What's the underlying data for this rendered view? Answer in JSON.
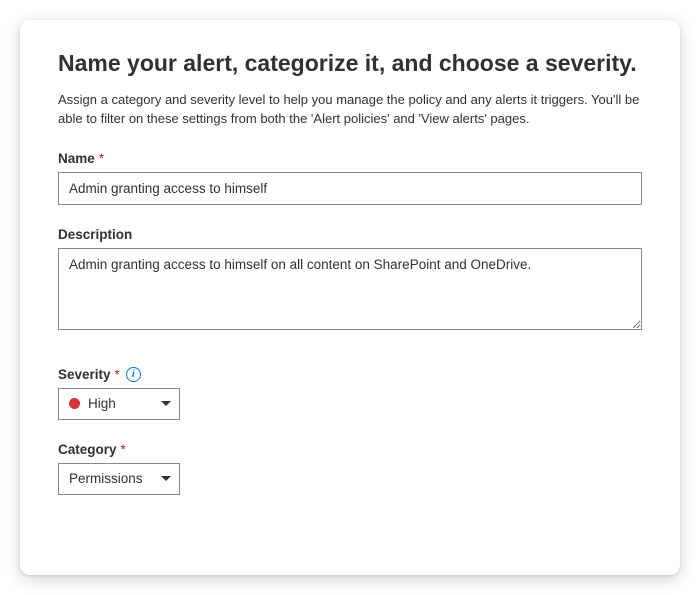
{
  "title": "Name your alert, categorize it, and choose a severity.",
  "subtitle": "Assign a category and severity level to help you manage the policy and any alerts it triggers. You'll be able to filter on these settings from both the 'Alert policies' and 'View alerts' pages.",
  "fields": {
    "name": {
      "label": "Name",
      "required_mark": "*",
      "value": "Admin granting access to himself"
    },
    "description": {
      "label": "Description",
      "value": "Admin granting access to himself on all content on SharePoint and OneDrive."
    },
    "severity": {
      "label": "Severity",
      "required_mark": "*",
      "value": "High",
      "dot_color": "#d13438"
    },
    "category": {
      "label": "Category",
      "required_mark": "*",
      "value": "Permissions"
    }
  },
  "icons": {
    "info_glyph": "i"
  }
}
